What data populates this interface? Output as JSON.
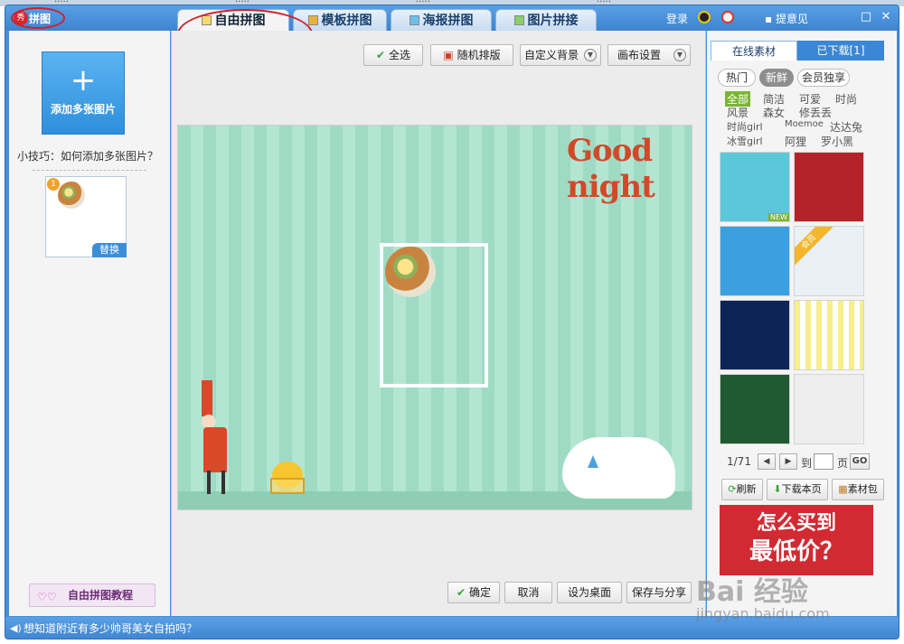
{
  "window": {
    "app_title": "拼图",
    "tabs": [
      {
        "label": "自由拼图",
        "active": true
      },
      {
        "label": "模板拼图",
        "active": false
      },
      {
        "label": "海报拼图",
        "active": false
      },
      {
        "label": "图片拼接",
        "active": false
      }
    ],
    "login": "登录",
    "feedback": "提意见"
  },
  "left": {
    "add_button": "添加多张图片",
    "tip": "小技巧：如何添加多张图片？",
    "thumb_index": "1",
    "replace": "替换",
    "tutorial": "自由拼图教程"
  },
  "toolbar": {
    "select_all": "全选",
    "random_layout": "随机排版",
    "custom_bg": "自定义背景",
    "canvas_settings": "画布设置"
  },
  "canvas": {
    "good_night_text": "Good night"
  },
  "actions": {
    "confirm": "确定",
    "cancel": "取消",
    "set_desktop": "设为桌面",
    "save_share": "保存与分享"
  },
  "right": {
    "tab_online": "在线素材",
    "tab_downloaded": "已下载[1]",
    "pills": [
      "热门",
      "新鲜",
      "会员独享"
    ],
    "active_pill": "新鲜",
    "categories": [
      "全部",
      "简洁",
      "可爱",
      "时尚",
      "风景",
      "森女",
      "修丢丢",
      "时尚girl",
      "Moemoe",
      "达达兔",
      "冰雪girl",
      "阿狸",
      "罗小黑"
    ],
    "active_category": "全部",
    "new_badge": "NEW",
    "vip_badge": "会员",
    "page_indicator": "1/71",
    "page_to": "到",
    "page_unit": "页",
    "go": "GO",
    "refresh": "刷新",
    "download_page": "下载本页",
    "material_pack": "素材包",
    "ad_line1": "怎么买到",
    "ad_line2": "最低价？"
  },
  "status": {
    "message": "想知道附近有多少帅哥美女自拍吗？"
  },
  "watermark": {
    "brand": "Bai 经验",
    "url": "jingyan.baidu.com"
  },
  "colors": {
    "accent_blue": "#3e84cf",
    "canvas_green": "#a8e0ca",
    "highlight_green": "#7ab532",
    "annotation_red": "#d0202a"
  }
}
